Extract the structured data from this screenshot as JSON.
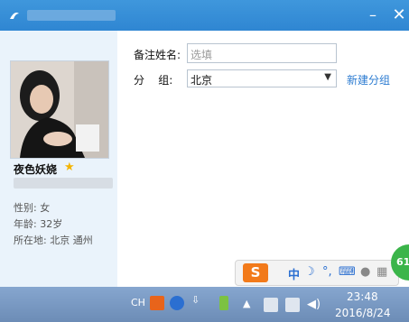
{
  "titlebar": {
    "minimize_icon": "minimize-icon",
    "close_icon": "close-icon"
  },
  "profile": {
    "nickname": "夜色妖娆",
    "gender": "性别: 女",
    "age": "年龄: 32岁",
    "location": "所在地: 北京  通州"
  },
  "form": {
    "remark_label": "备注姓名:",
    "remark_placeholder": "选填",
    "group_label": "分    组:",
    "group_value": "北京",
    "new_group_link": "新建分组"
  },
  "ime_bar": {
    "mode": "中",
    "punct": "°,",
    "badge": "61"
  },
  "taskbar": {
    "lang": "CH",
    "time": "23:48",
    "date": "2016/8/24"
  },
  "colors": {
    "titlebar": "#2f86d2",
    "left_panel": "#eaf3fb",
    "link": "#2b7bd1",
    "taskbar": "#6c8cb6"
  }
}
